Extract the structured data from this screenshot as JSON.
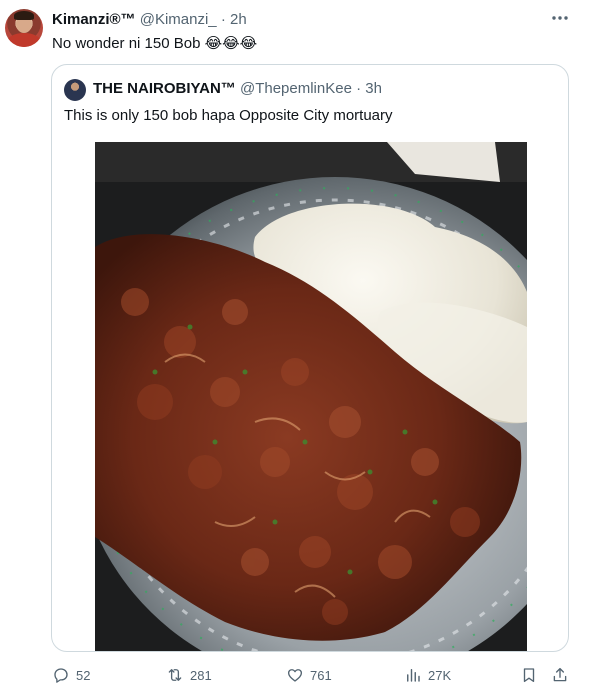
{
  "tweet": {
    "author_name": "Kimanzi®™",
    "author_handle": "@Kimanzi_",
    "separator": "·",
    "time": "2h",
    "text": "No wonder ni 150 Bob 😂😂😂",
    "more_icon": "ellipsis-icon"
  },
  "quote": {
    "author_name": "THE NAIROBIYAN™",
    "author_handle": "@ThepemlinKee",
    "separator": "·",
    "time": "3h",
    "text": "This is only 150 bob hapa Opposite City mortuary",
    "image_subject": "Plate of fried meat with ugali on a silver tray"
  },
  "actions": {
    "replies": "52",
    "reposts": "281",
    "likes": "761",
    "views": "27K",
    "reply_icon": "reply-icon",
    "repost_icon": "repost-icon",
    "like_icon": "heart-icon",
    "views_icon": "views-icon",
    "bookmark_icon": "bookmark-icon",
    "share_icon": "share-icon"
  },
  "colors": {
    "text": "#0f1419",
    "secondary": "#536471",
    "border": "#cfd9de"
  }
}
